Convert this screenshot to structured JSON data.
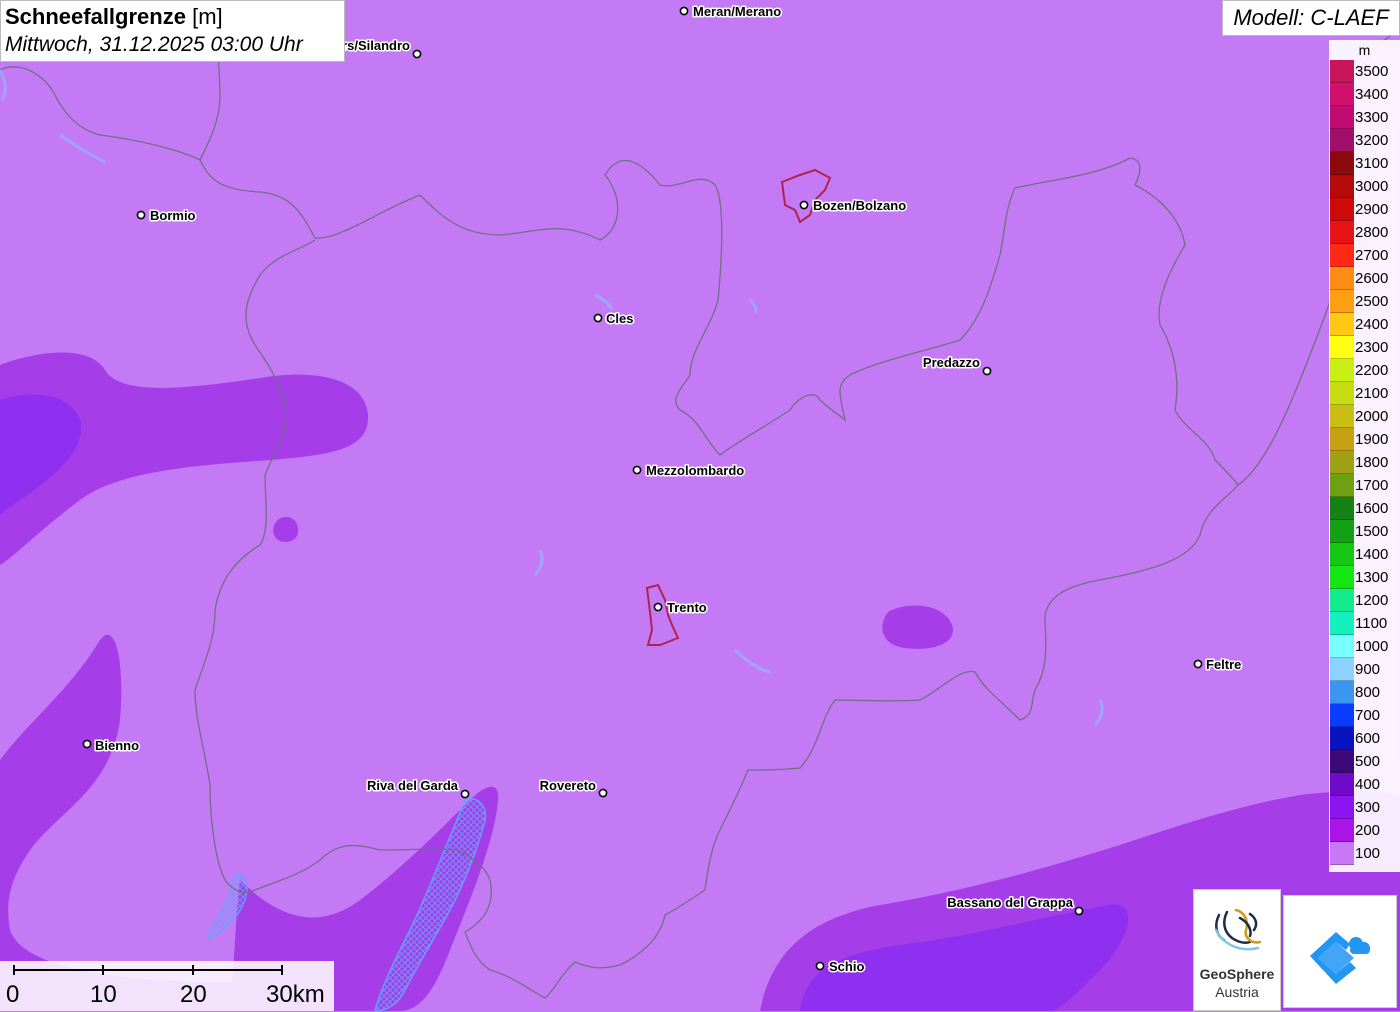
{
  "header": {
    "title": "Schneefallgrenze",
    "unit": "[m]",
    "datetime": "Mittwoch, 31.12.2025 03:00 Uhr"
  },
  "model_label": "Modell: C-LAEF",
  "legend": {
    "unit": "m",
    "items": [
      {
        "label": "3500",
        "color": "#c8145a"
      },
      {
        "label": "3400",
        "color": "#d2106e"
      },
      {
        "label": "3300",
        "color": "#c00c70"
      },
      {
        "label": "3200",
        "color": "#a0106a"
      },
      {
        "label": "3100",
        "color": "#8c0a0a"
      },
      {
        "label": "3000",
        "color": "#b40a0a"
      },
      {
        "label": "2900",
        "color": "#cd0a0a"
      },
      {
        "label": "2800",
        "color": "#e61414"
      },
      {
        "label": "2700",
        "color": "#ff2a14"
      },
      {
        "label": "2600",
        "color": "#ff8c14"
      },
      {
        "label": "2500",
        "color": "#ffa014"
      },
      {
        "label": "2400",
        "color": "#ffc814"
      },
      {
        "label": "2300",
        "color": "#ffff14"
      },
      {
        "label": "2200",
        "color": "#c8f014"
      },
      {
        "label": "2100",
        "color": "#c8dc14"
      },
      {
        "label": "2000",
        "color": "#c8be14"
      },
      {
        "label": "1900",
        "color": "#c8a014"
      },
      {
        "label": "1800",
        "color": "#a0a014"
      },
      {
        "label": "1700",
        "color": "#6ea014"
      },
      {
        "label": "1600",
        "color": "#148214"
      },
      {
        "label": "1500",
        "color": "#14a014"
      },
      {
        "label": "1400",
        "color": "#14c814"
      },
      {
        "label": "1300",
        "color": "#14e614"
      },
      {
        "label": "1200",
        "color": "#14eb8c"
      },
      {
        "label": "1100",
        "color": "#14f0be"
      },
      {
        "label": "1000",
        "color": "#78ffff"
      },
      {
        "label": "900",
        "color": "#8cd2ff"
      },
      {
        "label": "800",
        "color": "#3c96f0"
      },
      {
        "label": "700",
        "color": "#0a3cff"
      },
      {
        "label": "600",
        "color": "#0a14be"
      },
      {
        "label": "500",
        "color": "#3c0a78"
      },
      {
        "label": "400",
        "color": "#6e0ac8"
      },
      {
        "label": "300",
        "color": "#8c14f0"
      },
      {
        "label": "200",
        "color": "#aa14e6"
      },
      {
        "label": "100",
        "color": "#c878f5"
      }
    ]
  },
  "cities": [
    {
      "name": "Meran/Merano"
    },
    {
      "name": "Schlanders/Silandro"
    },
    {
      "name": "Bormio"
    },
    {
      "name": "Bozen/Bolzano"
    },
    {
      "name": "Cles"
    },
    {
      "name": "Predazzo"
    },
    {
      "name": "Mezzolombardo"
    },
    {
      "name": "Trento"
    },
    {
      "name": "Feltre"
    },
    {
      "name": "Bienno"
    },
    {
      "name": "Riva del Garda"
    },
    {
      "name": "Rovereto"
    },
    {
      "name": "Bassano del Grappa"
    },
    {
      "name": "Schio"
    }
  ],
  "scale_bar": {
    "labels": [
      "0",
      "10",
      "20",
      "30km"
    ]
  },
  "logos": {
    "geosphere_name": "GeoSphere",
    "geosphere_sub": "Austria",
    "geosphere_icon": "geosphere-logo-icon",
    "app_icon": "warning-app-icon"
  }
}
